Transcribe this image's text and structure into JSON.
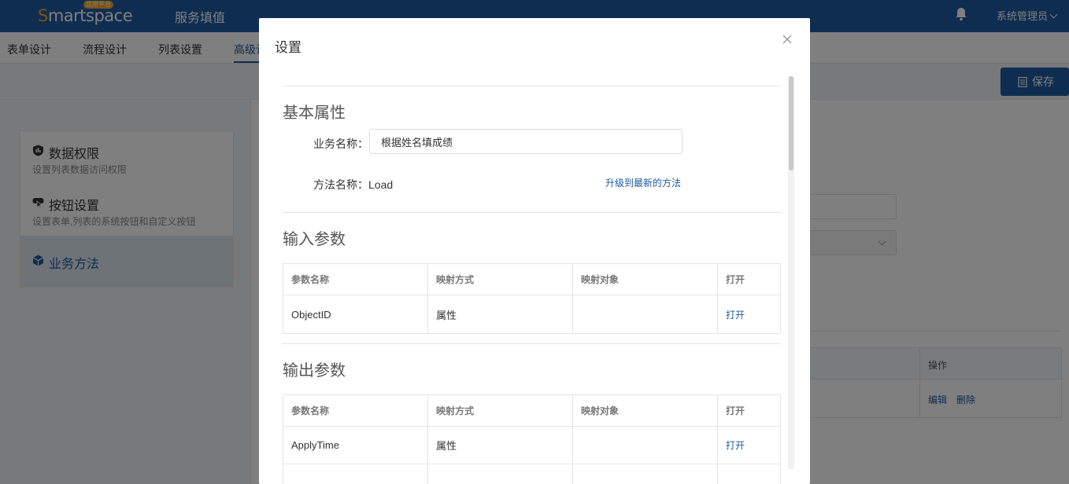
{
  "header": {
    "logo_prefix": "S",
    "logo_rest": "martspace",
    "logo_badge": "应用平台",
    "app_title": "服务填值",
    "user_name": "系统管理员"
  },
  "tabs": [
    {
      "label": "表单设计"
    },
    {
      "label": "流程设计"
    },
    {
      "label": "列表设置"
    },
    {
      "label": "高级设"
    }
  ],
  "toolbar": {
    "save_label": "保存"
  },
  "left_menu": [
    {
      "title": "数据权限",
      "subtitle": "设置列表数据访问权限"
    },
    {
      "title": "按钮设置",
      "subtitle": "设置表单,列表的系统按钮和自定义按钮"
    },
    {
      "title": "业务方法",
      "subtitle": ""
    }
  ],
  "background_table": {
    "op_header": "操作",
    "edit_label": "编辑",
    "delete_label": "删除"
  },
  "modal": {
    "title": "设置",
    "basic": {
      "section_title": "基本属性",
      "business_name_label": "业务名称：",
      "business_name_value": "根据姓名填成绩",
      "method_name_label": "方法名称：Load",
      "upgrade_link": "升级到最新的方法"
    },
    "input_params": {
      "section_title": "输入参数",
      "headers": [
        "参数名称",
        "映射方式",
        "映射对象",
        "打开"
      ],
      "rows": [
        {
          "name": "ObjectID",
          "mapping": "属性",
          "target": "",
          "action": "打开"
        }
      ]
    },
    "output_params": {
      "section_title": "输出参数",
      "headers": [
        "参数名称",
        "映射方式",
        "映射对象",
        "打开"
      ],
      "rows": [
        {
          "name": "ApplyTime",
          "mapping": "属性",
          "target": "",
          "action": "打开"
        }
      ]
    }
  }
}
